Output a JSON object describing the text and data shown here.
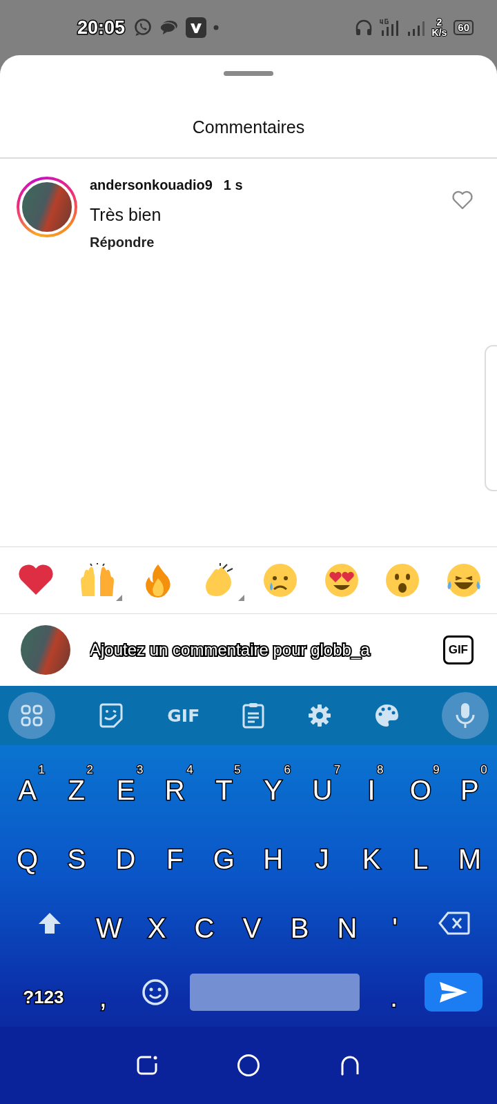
{
  "status_bar": {
    "time": "20:05",
    "net_speed_value": "2",
    "net_speed_unit": "K/s",
    "battery": "60"
  },
  "sheet": {
    "title": "Commentaires"
  },
  "comments": [
    {
      "username": "andersonkouadio9",
      "time": "1 s",
      "text": "Très bien",
      "reply_label": "Répondre",
      "liked": false,
      "story_ring": true
    }
  ],
  "reactions": [
    {
      "kind": "heart",
      "has_variants": false
    },
    {
      "kind": "raised_hands",
      "has_variants": true
    },
    {
      "kind": "fire",
      "has_variants": false
    },
    {
      "kind": "clap",
      "has_variants": true
    },
    {
      "kind": "crying",
      "has_variants": false
    },
    {
      "kind": "heart_eyes",
      "has_variants": false
    },
    {
      "kind": "surprised",
      "has_variants": false
    },
    {
      "kind": "laughing",
      "has_variants": false
    }
  ],
  "composer": {
    "placeholder": "Ajoutez un commentaire pour globb_a",
    "gif_label": "GIF"
  },
  "keyboard": {
    "toolbar_gif": "GIF",
    "rows": [
      [
        {
          "kind": "char",
          "label": "A",
          "hint": "1"
        },
        {
          "kind": "char",
          "label": "Z",
          "hint": "2"
        },
        {
          "kind": "char",
          "label": "E",
          "hint": "3"
        },
        {
          "kind": "char",
          "label": "R",
          "hint": "4"
        },
        {
          "kind": "char",
          "label": "T",
          "hint": "5"
        },
        {
          "kind": "char",
          "label": "Y",
          "hint": "6"
        },
        {
          "kind": "char",
          "label": "U",
          "hint": "7"
        },
        {
          "kind": "char",
          "label": "I",
          "hint": "8"
        },
        {
          "kind": "char",
          "label": "O",
          "hint": "9"
        },
        {
          "kind": "char",
          "label": "P",
          "hint": "0"
        }
      ],
      [
        {
          "kind": "char",
          "label": "Q"
        },
        {
          "kind": "char",
          "label": "S"
        },
        {
          "kind": "char",
          "label": "D"
        },
        {
          "kind": "char",
          "label": "F"
        },
        {
          "kind": "char",
          "label": "G"
        },
        {
          "kind": "char",
          "label": "H"
        },
        {
          "kind": "char",
          "label": "J"
        },
        {
          "kind": "char",
          "label": "K"
        },
        {
          "kind": "char",
          "label": "L"
        },
        {
          "kind": "char",
          "label": "M"
        }
      ],
      [
        {
          "kind": "shift"
        },
        {
          "kind": "char",
          "label": "W"
        },
        {
          "kind": "char",
          "label": "X"
        },
        {
          "kind": "char",
          "label": "C"
        },
        {
          "kind": "char",
          "label": "V"
        },
        {
          "kind": "char",
          "label": "B"
        },
        {
          "kind": "char",
          "label": "N"
        },
        {
          "kind": "char",
          "label": "'"
        },
        {
          "kind": "backspace"
        }
      ],
      [
        {
          "kind": "symbols",
          "label": "?123"
        },
        {
          "kind": "char",
          "label": ","
        },
        {
          "kind": "emoji"
        },
        {
          "kind": "space"
        },
        {
          "kind": "char",
          "label": "."
        },
        {
          "kind": "send"
        }
      ]
    ]
  }
}
